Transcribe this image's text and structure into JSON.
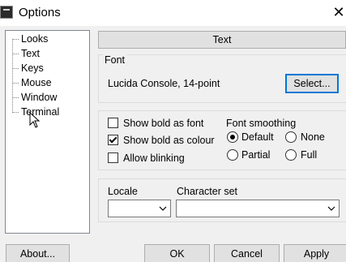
{
  "window": {
    "title": "Options"
  },
  "tree": {
    "items": [
      "Looks",
      "Text",
      "Keys",
      "Mouse",
      "Window",
      "Terminal"
    ]
  },
  "panel": {
    "header": "Text"
  },
  "font_group": {
    "label": "Font",
    "current_font": "Lucida Console, 14-point",
    "select_label": "Select..."
  },
  "options": {
    "show_bold_as_font": {
      "label": "Show bold as font",
      "checked": false
    },
    "show_bold_as_colour": {
      "label": "Show bold as colour",
      "checked": true
    },
    "allow_blinking": {
      "label": "Allow blinking",
      "checked": false
    }
  },
  "font_smoothing": {
    "label": "Font smoothing",
    "options": [
      "Default",
      "None",
      "Partial",
      "Full"
    ],
    "selected": "Default"
  },
  "locale": {
    "label": "Locale",
    "value": ""
  },
  "charset": {
    "label": "Character set",
    "value": ""
  },
  "buttons": {
    "about": "About...",
    "ok": "OK",
    "cancel": "Cancel",
    "apply": "Apply"
  },
  "icons": {
    "app": "terminal-icon",
    "close": "close-icon",
    "cursor": "mouse-pointer-icon",
    "dropdown": "chevron-down-icon"
  }
}
